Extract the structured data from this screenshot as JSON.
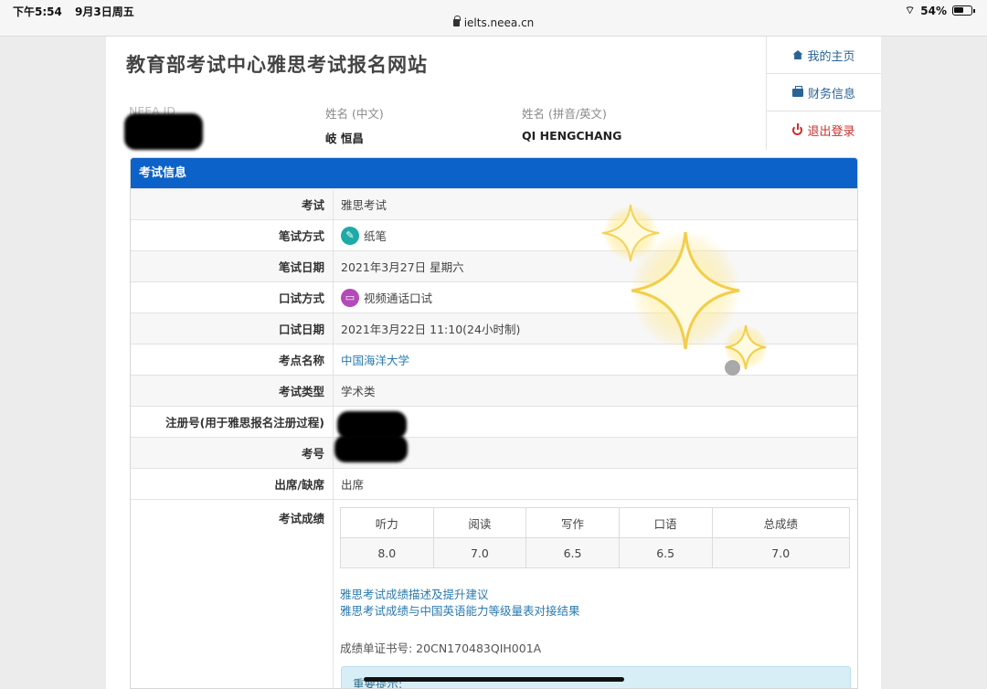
{
  "status_bar": {
    "time": "下午5:54",
    "date": "9月3日周五",
    "battery": "54%"
  },
  "address_bar": {
    "url": "ielts.neea.cn"
  },
  "header": {
    "site_title": "教育部考试中心雅思考试报名网站",
    "neea_id_label": "NEEA ID",
    "name_cn_label": "姓名 (中文)",
    "name_cn_value": "岐 恒昌",
    "name_en_label": "姓名 (拼音/英文)",
    "name_en_value": "QI HENGCHANG"
  },
  "nav": {
    "home": "我的主页",
    "finance": "财务信息",
    "logout": "退出登录"
  },
  "panel": {
    "title": "考试信息",
    "rows": {
      "exam_label": "考试",
      "exam_value": "雅思考试",
      "written_mode_label": "笔试方式",
      "written_mode_value": "纸笔",
      "written_date_label": "笔试日期",
      "written_date_value": "2021年3月27日 星期六",
      "speaking_mode_label": "口试方式",
      "speaking_mode_value": "视频通话口试",
      "speaking_date_label": "口试日期",
      "speaking_date_value": "2021年3月22日 11:10(24小时制)",
      "venue_label": "考点名称",
      "venue_value": "中国海洋大学",
      "type_label": "考试类型",
      "type_value": "学术类",
      "reg_label": "注册号(用于雅思报名注册过程)",
      "cand_label": "考号",
      "attendance_label": "出席/缺席",
      "attendance_value": "出席",
      "score_label": "考试成绩"
    },
    "scores": {
      "headers": [
        "听力",
        "阅读",
        "写作",
        "口语",
        "总成绩"
      ],
      "values": [
        "8.0",
        "7.0",
        "6.5",
        "6.5",
        "7.0"
      ]
    },
    "link_desc": "雅思考试成绩描述及提升建议",
    "link_cse": "雅思考试成绩与中国英语能力等级量表对接结果",
    "cert_number": "成绩单证书号: 20CN170483QIH001A",
    "notice_title": "重要提示:"
  },
  "colors": {
    "panel_header": "#0c62c8",
    "link": "#2a7ab0",
    "logout": "#c9302c"
  }
}
